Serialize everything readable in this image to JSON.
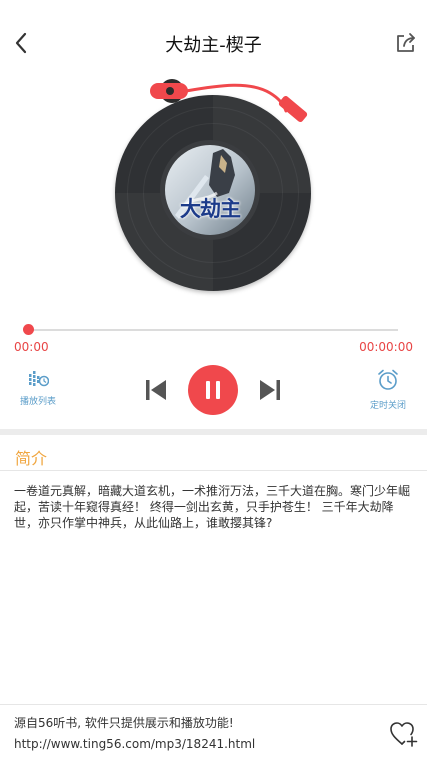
{
  "header": {
    "title": "大劫主-楔子",
    "back_icon": "chevron-left-icon",
    "share_icon": "share-icon"
  },
  "cover": {
    "title": "大劫主"
  },
  "player": {
    "current_time": "00:00",
    "total_time": "00:00:00",
    "progress": 0,
    "playlist_label": "播放列表",
    "timer_label": "定时关闭",
    "accent_color": "#f0484c",
    "icons": [
      "playlist-icon",
      "prev-icon",
      "pause-icon",
      "next-icon",
      "alarm-clock-icon"
    ]
  },
  "intro": {
    "heading": "简介",
    "text": "一卷道元真解，暗藏大道玄机，一术推洐万法，三千大道在胸。寒门少年崛起，苦读十年窥得真经！ 终得一剑出玄黄，只手护苍生！ 三千年大劫降世，亦只作掌中神兵，从此仙路上，谁敢撄其锋?"
  },
  "footer": {
    "source_text": "源自56听书, 软件只提供展示和播放功能!",
    "url": "http://www.ting56.com/mp3/18241.html",
    "favorite_icon": "heart-plus-icon"
  }
}
